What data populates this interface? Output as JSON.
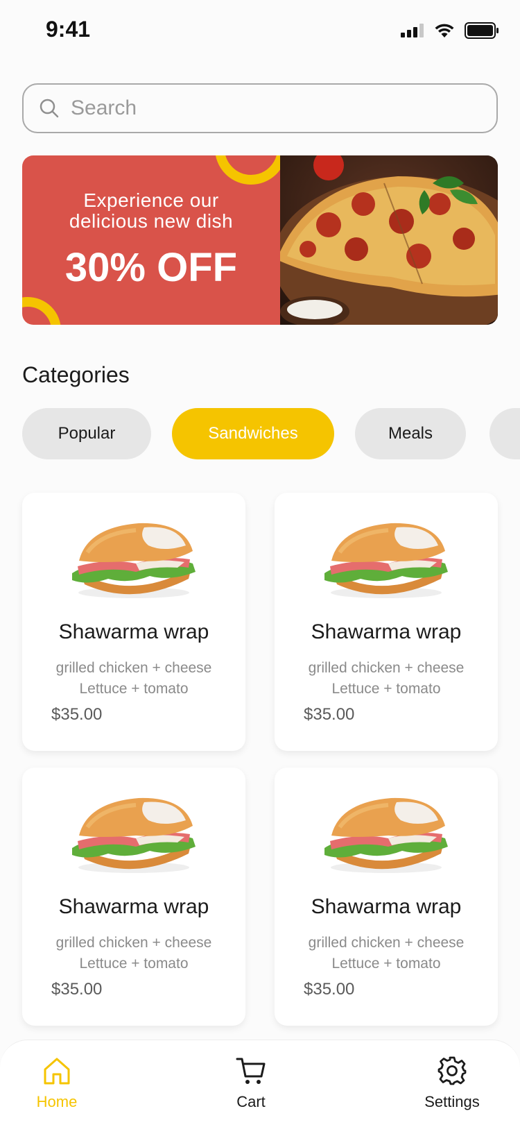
{
  "status_bar": {
    "time": "9:41"
  },
  "search": {
    "placeholder": "Search"
  },
  "banner": {
    "subtitle_line1": "Experience our",
    "subtitle_line2": "delicious new dish",
    "headline": "30% OFF"
  },
  "categories": {
    "title": "Categories",
    "items": [
      "Popular",
      "Sandwiches",
      "Meals",
      ""
    ],
    "selected": "Sandwiches"
  },
  "products": [
    {
      "name": "Shawarma wrap",
      "desc_line1": "grilled chicken + cheese",
      "desc_line2": "Lettuce + tomato",
      "price": "$35.00"
    },
    {
      "name": "Shawarma wrap",
      "desc_line1": "grilled chicken + cheese",
      "desc_line2": "Lettuce + tomato",
      "price": "$35.00"
    },
    {
      "name": "Shawarma wrap",
      "desc_line1": "grilled chicken + cheese",
      "desc_line2": "Lettuce + tomato",
      "price": "$35.00"
    },
    {
      "name": "Shawarma wrap",
      "desc_line1": "grilled chicken + cheese",
      "desc_line2": "Lettuce + tomato",
      "price": "$35.00"
    }
  ],
  "bottom_nav": {
    "items": [
      {
        "label": "Home",
        "icon": "home-icon",
        "active": true
      },
      {
        "label": "Cart",
        "icon": "cart-icon",
        "active": false
      },
      {
        "label": "Settings",
        "icon": "gear-icon",
        "active": false
      }
    ]
  },
  "colors": {
    "accent": "#f5c400",
    "banner": "#d9534a",
    "background": "#fbfbfb"
  }
}
